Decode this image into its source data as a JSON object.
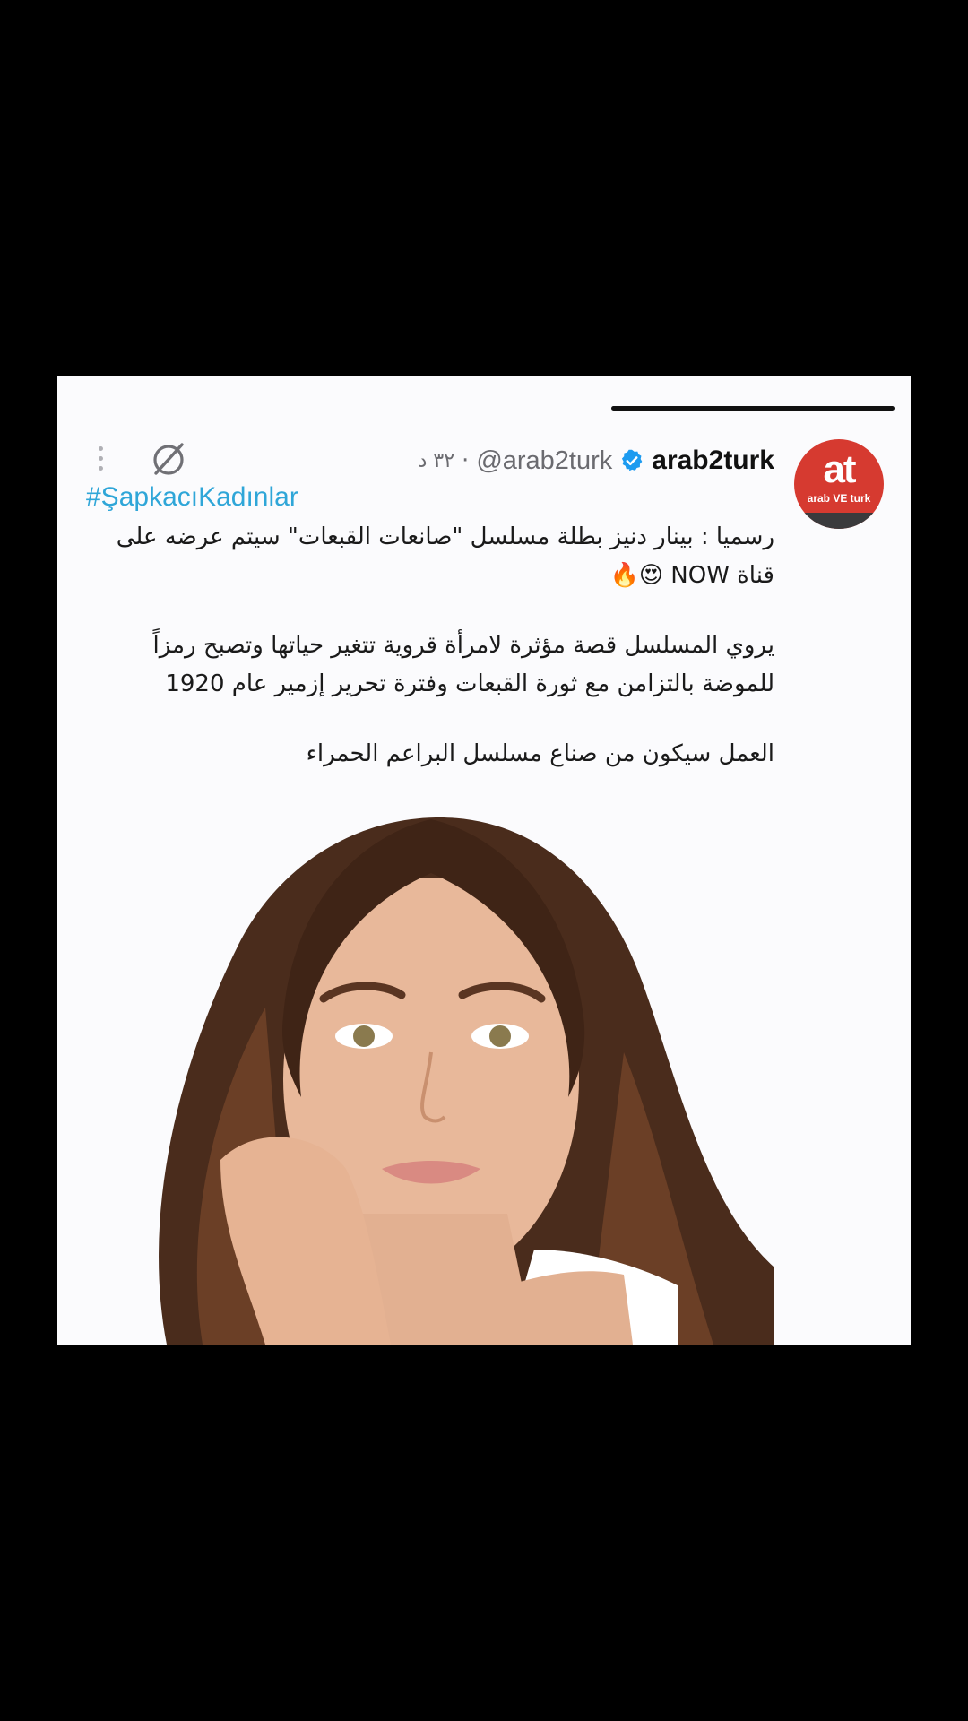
{
  "tweet": {
    "display_name": "arab2turk",
    "handle": "@arab2turk",
    "separator": "·",
    "time": "٣٢ د",
    "hashtag": "#ŞapkacıKadınlar",
    "paragraphs": [
      [
        "رسميا : بينار دنيز بطلة مسلسل \"صانعات القبعات\" سيتم عرضه على",
        "قناة NOW 😍🔥"
      ],
      [
        "يروي المسلسل قصة مؤثرة لامرأة قروية تتغير حياتها وتصبح رمزاً",
        "للموضة بالتزامن مع ثورة القبعات وفترة تحرير إزمير عام 1920"
      ],
      [
        "العمل سيكون من صناع مسلسل البراعم الحمراء"
      ]
    ]
  },
  "avatar": {
    "mark": "at",
    "sub": "arab VE turk"
  },
  "icons": {
    "verified": "verified-badge-icon",
    "grok": "grok-icon",
    "more": "more-vertical-icon"
  },
  "colors": {
    "background": "#000000",
    "card": "#fbfbfd",
    "verified": "#1d9bf0",
    "hashtag": "#2fa6d8",
    "avatar": "#d63a30"
  }
}
